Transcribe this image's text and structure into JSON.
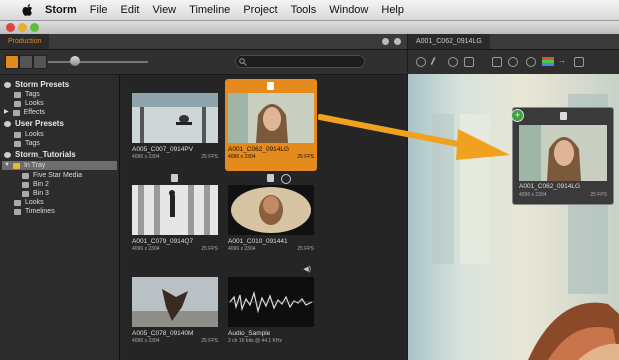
{
  "menubar": {
    "app": "Storm",
    "items": [
      "File",
      "Edit",
      "View",
      "Timeline",
      "Project",
      "Tools",
      "Window",
      "Help"
    ]
  },
  "browser": {
    "tab_label": "Production",
    "search_placeholder": ""
  },
  "sidebar": {
    "rows": [
      {
        "label": "Storm Presets",
        "kind": "section"
      },
      {
        "label": "Tags",
        "kind": "item"
      },
      {
        "label": "Looks",
        "kind": "item"
      },
      {
        "label": "Effects",
        "kind": "item"
      },
      {
        "label": "User Presets",
        "kind": "section"
      },
      {
        "label": "Looks",
        "kind": "item"
      },
      {
        "label": "Tags",
        "kind": "item"
      },
      {
        "label": "Storm_Tutorials",
        "kind": "section"
      },
      {
        "label": "In Tray",
        "kind": "item"
      },
      {
        "label": "Five Star Media",
        "kind": "item"
      },
      {
        "label": "Bin 2",
        "kind": "item"
      },
      {
        "label": "Bin 3",
        "kind": "item"
      },
      {
        "label": "Looks",
        "kind": "item"
      },
      {
        "label": "Timelines",
        "kind": "item"
      }
    ]
  },
  "clips": [
    {
      "name": "A005_C007_0914PV",
      "res": "4096 x 2304",
      "fps": "25 FPS"
    },
    {
      "name": "A001_C062_0914LG",
      "res": "4096 x 2304",
      "fps": "25 FPS"
    },
    {
      "name": "A001_C079_0914Q7",
      "res": "4096 x 2304",
      "fps": "25 FPS"
    },
    {
      "name": "A001_C010_091441",
      "res": "4096 x 2304",
      "fps": "25 FPS"
    },
    {
      "name": "A005_C078_09140M",
      "res": "4096 x 2304",
      "fps": "25 FPS"
    },
    {
      "name": "Audio_Sample",
      "res": "2 ch 16 bits @ 44.1 KHz",
      "fps": ""
    }
  ],
  "viewer": {
    "tab_label": "A001_C062_0914LG"
  },
  "drag_preview": {
    "name": "A001_C062_0914LG",
    "res": "4096 x 2304",
    "fps": "25 FPS",
    "badge": "+"
  },
  "colors": {
    "accent": "#e58a1c",
    "arrow": "#f0a21e"
  }
}
